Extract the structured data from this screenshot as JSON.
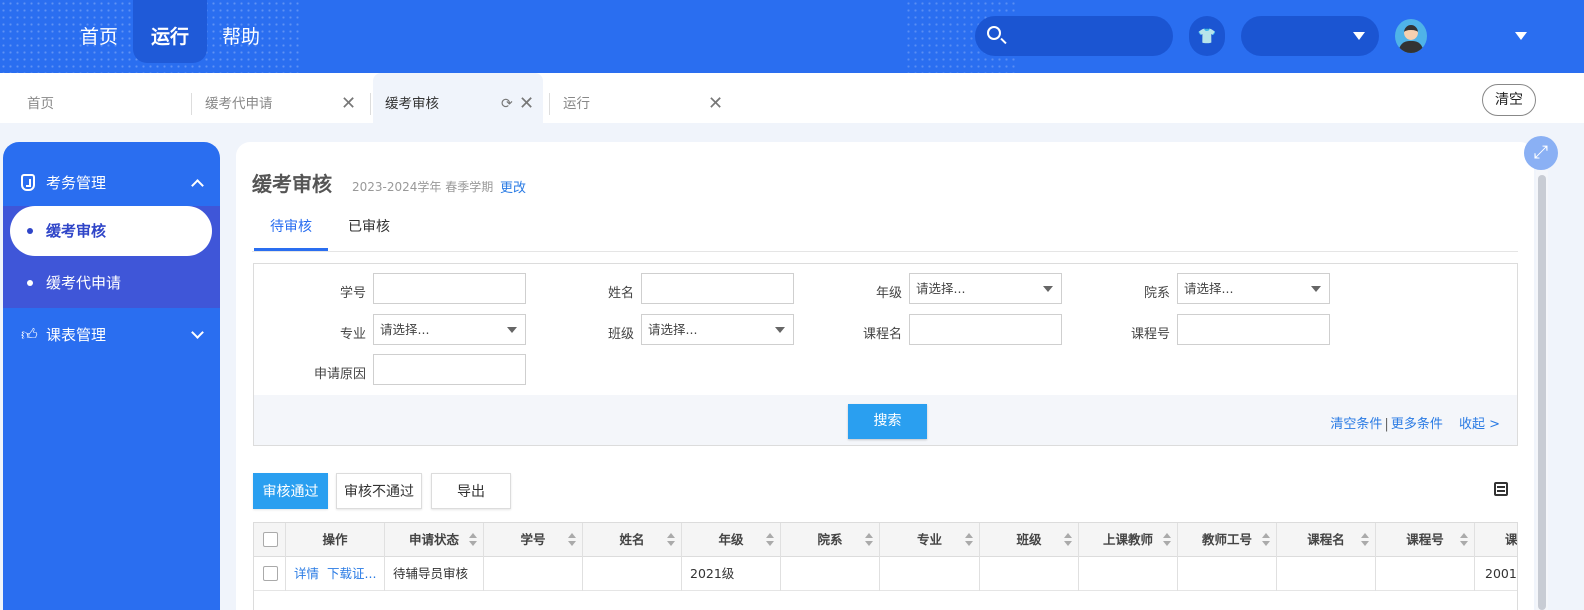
{
  "topnav": {
    "items": [
      {
        "label": "首页",
        "active": false
      },
      {
        "label": "运行",
        "active": true
      },
      {
        "label": "帮助",
        "active": false
      }
    ],
    "search_placeholder": ""
  },
  "tabs": [
    {
      "label": "首页",
      "closable": false,
      "active": false
    },
    {
      "label": "缓考代申请",
      "closable": true,
      "active": false
    },
    {
      "label": "缓考审核",
      "closable": true,
      "active": true
    },
    {
      "label": "运行",
      "closable": true,
      "active": false
    }
  ],
  "clear_tabs_label": "清空",
  "sidebar": {
    "groups": [
      {
        "label": "考务管理",
        "expanded": true,
        "items": [
          {
            "label": "缓考审核",
            "active": true
          },
          {
            "label": "缓考代申请",
            "active": false
          }
        ]
      },
      {
        "label": "课表管理",
        "expanded": false,
        "items": []
      }
    ]
  },
  "page": {
    "title": "缓考审核",
    "term": "2023-2024学年 春季学期",
    "change_label": "更改",
    "subtabs": [
      "待审核",
      "已审核"
    ]
  },
  "filters": {
    "student_id": {
      "label": "学号",
      "value": ""
    },
    "name": {
      "label": "姓名",
      "value": ""
    },
    "grade": {
      "label": "年级",
      "value": "请选择..."
    },
    "department": {
      "label": "院系",
      "value": "请选择..."
    },
    "major": {
      "label": "专业",
      "value": "请选择..."
    },
    "class": {
      "label": "班级",
      "value": "请选择..."
    },
    "course_name": {
      "label": "课程名",
      "value": ""
    },
    "course_no": {
      "label": "课程号",
      "value": ""
    },
    "reason": {
      "label": "申请原因",
      "value": ""
    },
    "search_label": "搜索",
    "clear_label": "清空条件",
    "divider": "|",
    "more_label": "更多条件",
    "collapse_label": "收起 >"
  },
  "actions": {
    "approve": "审核通过",
    "reject": "审核不通过",
    "export": "导出"
  },
  "table": {
    "columns": [
      "操作",
      "申请状态",
      "学号",
      "姓名",
      "年级",
      "院系",
      "专业",
      "班级",
      "上课教师",
      "教师工号",
      "课程名",
      "课程号",
      "课"
    ],
    "rows": [
      {
        "actions": [
          "详情",
          "下载证..."
        ],
        "status": "待辅导员审核",
        "student_id": "",
        "name": "",
        "grade": "2021级",
        "department": "",
        "major": "",
        "class": "",
        "teacher": "",
        "teacher_id": "",
        "course_name": "",
        "course_no": "",
        "extra": "2001"
      }
    ]
  },
  "colors": {
    "primary": "#2a6ef0",
    "button": "#2a9ff0",
    "link": "#2a7be4",
    "submenu": "#3f56d8"
  }
}
